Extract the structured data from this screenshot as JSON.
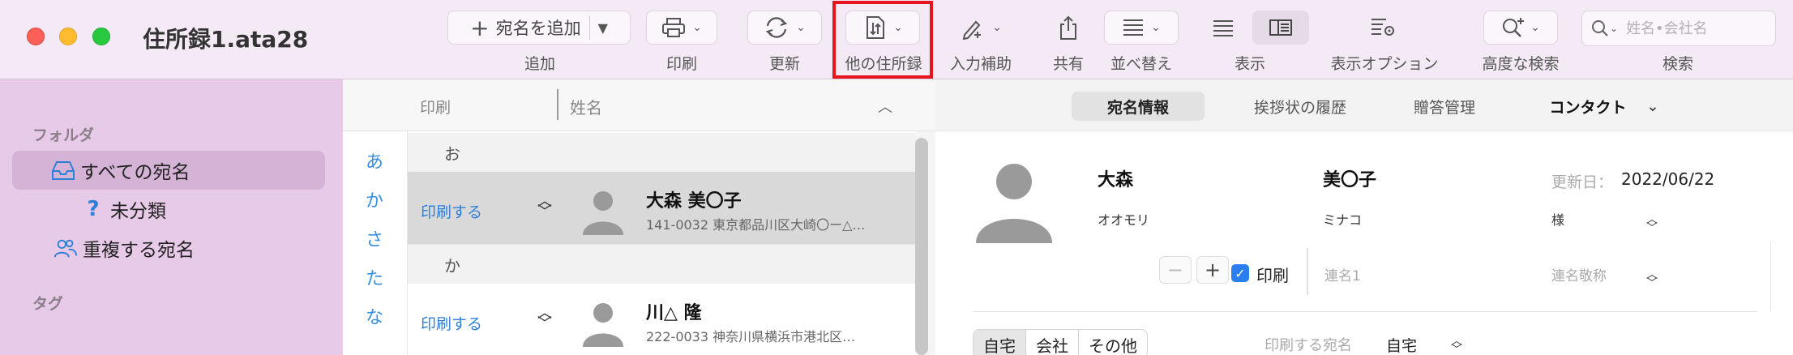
{
  "window": {
    "title": "住所録1.ata28"
  },
  "toolbar": {
    "add_button_label": "宛名を追加",
    "add_label": "追加",
    "print_label": "印刷",
    "update_label": "更新",
    "other_label": "他の住所録",
    "input_assist_label": "入力補助",
    "share_label": "共有",
    "sort_label": "並べ替え",
    "view_label": "表示",
    "view_options_label": "表示オプション",
    "advanced_search_label": "高度な検索",
    "search_label": "検索",
    "search_placeholder": "姓名•会社名",
    "highlight_color": "#e5141f"
  },
  "sidebar": {
    "folders_header": "フォルダ",
    "items": [
      {
        "label": "すべての宛名",
        "icon": "tray-icon",
        "selected": true
      },
      {
        "label": "未分類",
        "icon": "question-icon"
      },
      {
        "label": "重複する宛名",
        "icon": "people-icon"
      }
    ],
    "tags_header": "タグ"
  },
  "list": {
    "header_print": "印刷",
    "header_name": "姓名",
    "index": [
      "あ",
      "か",
      "さ",
      "た",
      "な"
    ],
    "sections": [
      {
        "heading": "お",
        "rows": [
          {
            "print": "印刷する",
            "name": "大森 美〇子",
            "address": "141-0032 東京都品川区大崎〇ー△…",
            "selected": true
          }
        ]
      },
      {
        "heading": "か",
        "rows": [
          {
            "print": "印刷する",
            "name": "川△ 隆",
            "address": "222-0033 神奈川県横浜市港北区…"
          }
        ]
      }
    ]
  },
  "detail": {
    "tabs": [
      "宛名情報",
      "挨拶状の履歴",
      "贈答管理",
      "コンタクト"
    ],
    "last_name": "大森",
    "first_name": "美〇子",
    "last_kana": "オオモリ",
    "first_kana": "ミナコ",
    "updated_label": "更新日：",
    "updated_date": "2022/06/22",
    "honorific": "様",
    "print_checkbox_label": "印刷",
    "joint_name_placeholder": "連名1",
    "joint_honorific_placeholder": "連名敬称",
    "address_tabs": [
      "自宅",
      "会社",
      "その他"
    ],
    "print_address_label": "印刷する宛名",
    "print_address_value": "自宅"
  }
}
